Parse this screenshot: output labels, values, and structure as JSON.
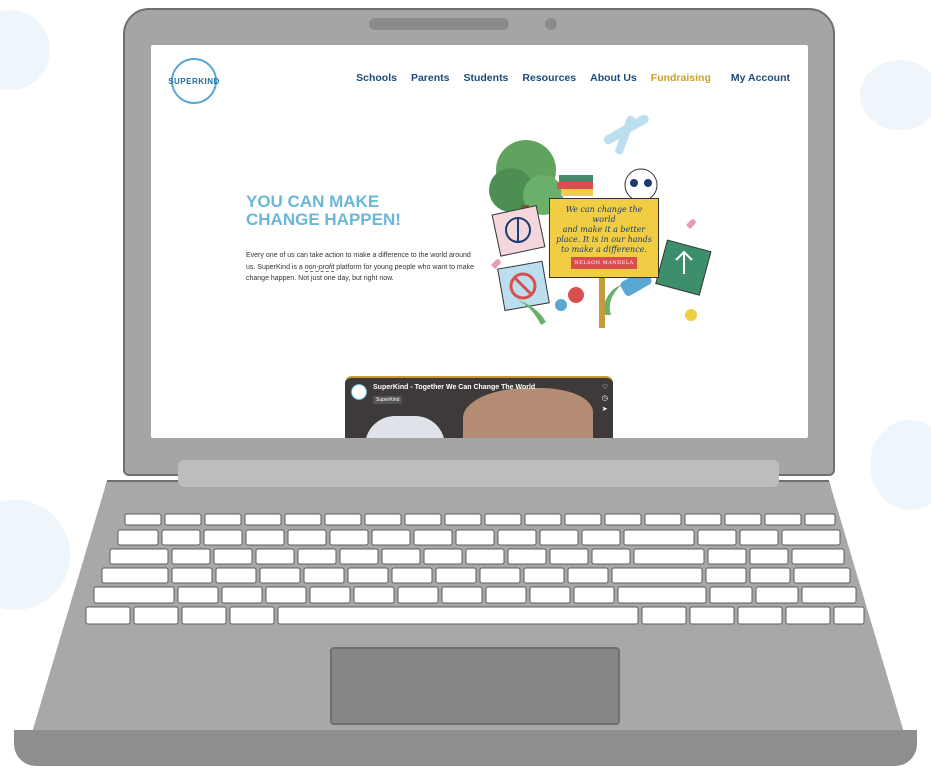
{
  "nav": {
    "items": [
      "Schools",
      "Parents",
      "Students",
      "Resources",
      "About Us",
      "Fundraising"
    ],
    "account": "My Account"
  },
  "logo": {
    "text": "SUPERKIND"
  },
  "hero": {
    "title_line1": "YOU CAN MAKE",
    "title_line2": "CHANGE HAPPEN!",
    "text_before": "Every one of us can take action to make a difference to the world around us. SuperKind is a",
    "text_highlight": "non-profit",
    "text_after": "platform for young people who want to make change happen. Not just one day, but right now."
  },
  "quote": {
    "line1": "We can change the world",
    "line2": "and make it a better",
    "line3": "place. It is in our hands",
    "line4": "to make a difference.",
    "author": "NELSON MANDELA"
  },
  "video": {
    "title": "SuperKind - Together We Can Change The World",
    "channel": "SuperKind",
    "icons": [
      "heart-icon",
      "clock-icon",
      "share-icon"
    ]
  },
  "colors": {
    "nav": "#1e4a7a",
    "fundraising": "#c9a12a",
    "hero_title": "#6bb7db",
    "laptop": "#a5a5a5"
  }
}
